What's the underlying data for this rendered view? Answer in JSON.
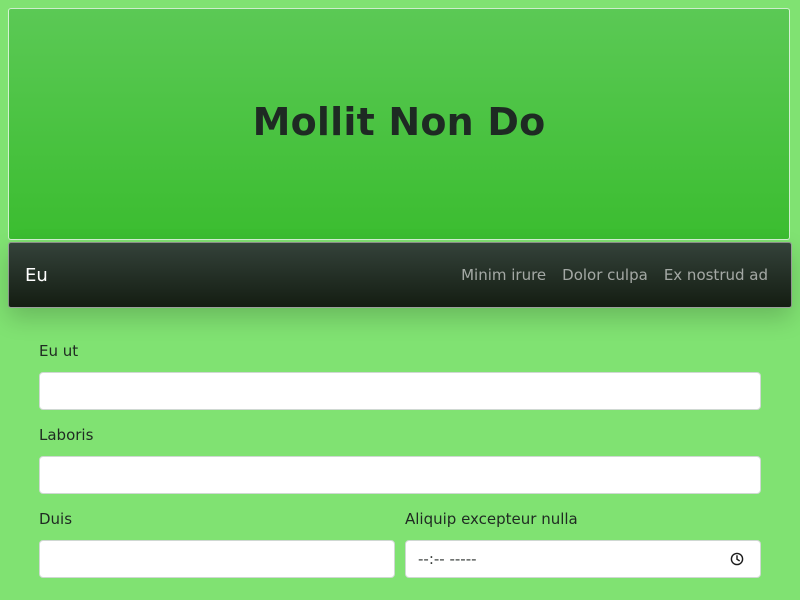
{
  "hero": {
    "title": "Mollit Non Do"
  },
  "navbar": {
    "brand": "Eu",
    "links": [
      "Minim irure",
      "Dolor culpa",
      "Ex nostrud ad"
    ]
  },
  "form": {
    "field1": {
      "label": "Eu ut",
      "value": "",
      "placeholder": ""
    },
    "field2": {
      "label": "Laboris",
      "value": "",
      "placeholder": ""
    },
    "field3": {
      "label": "Duis",
      "value": "",
      "placeholder": ""
    },
    "field4": {
      "label": "Aliquip excepteur nulla",
      "display": "--:-- -----",
      "icon": "clock-icon"
    }
  },
  "colors": {
    "page_background": "#80e272",
    "hero_gradient_top": "#5bc955",
    "hero_gradient_bottom": "#3bbd30",
    "navbar_top": "#34423a",
    "navbar_bottom": "#141d12"
  }
}
